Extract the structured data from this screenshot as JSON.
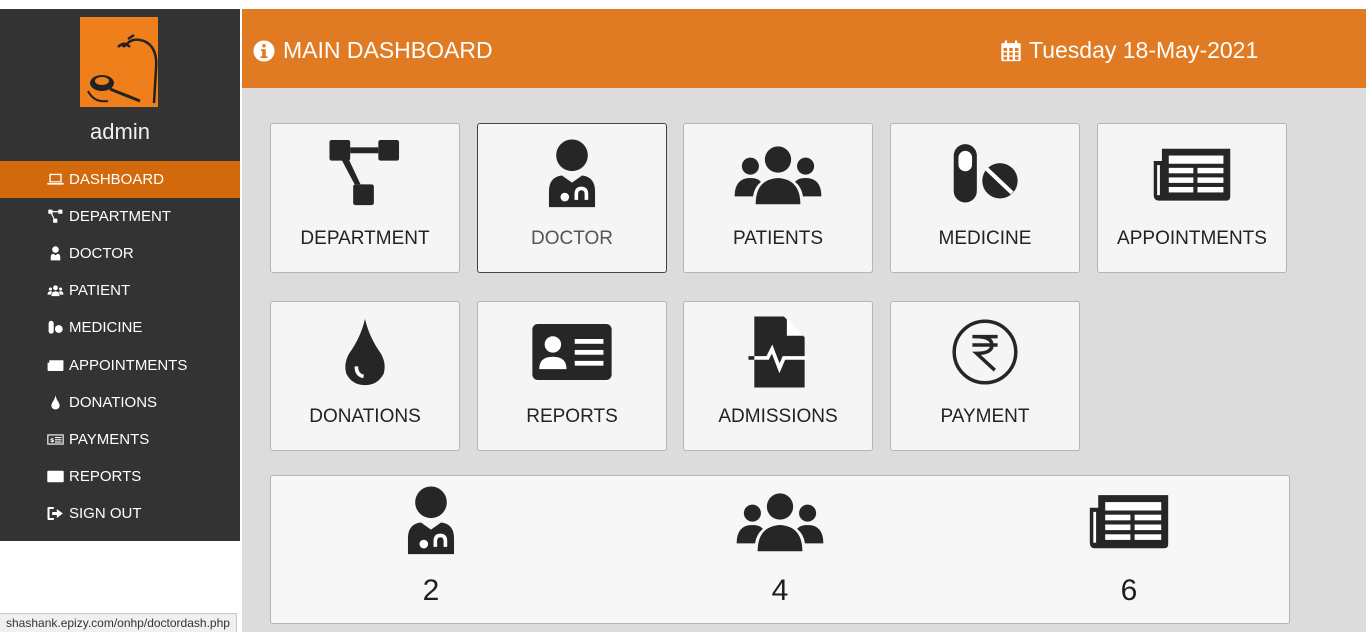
{
  "sidebar": {
    "user": "admin",
    "items": [
      {
        "label": "DASHBOARD",
        "icon": "laptop-icon",
        "active": true
      },
      {
        "label": "DEPARTMENT",
        "icon": "sitemap-icon"
      },
      {
        "label": "DOCTOR",
        "icon": "doctor-icon"
      },
      {
        "label": "PATIENT",
        "icon": "users-icon"
      },
      {
        "label": "MEDICINE",
        "icon": "pills-icon"
      },
      {
        "label": "APPOINTMENTS",
        "icon": "newspaper-icon"
      },
      {
        "label": "DONATIONS",
        "icon": "tint-icon"
      },
      {
        "label": "PAYMENTS",
        "icon": "money-icon"
      },
      {
        "label": "REPORTS",
        "icon": "id-card-icon"
      },
      {
        "label": "SIGN OUT",
        "icon": "sign-out-icon"
      }
    ]
  },
  "header": {
    "title": "MAIN DASHBOARD",
    "date": "Tuesday 18-May-2021"
  },
  "tiles": [
    {
      "label": "DEPARTMENT",
      "icon": "sitemap-icon"
    },
    {
      "label": "DOCTOR",
      "icon": "doctor-icon",
      "selected": true
    },
    {
      "label": "PATIENTS",
      "icon": "users-icon"
    },
    {
      "label": "MEDICINE",
      "icon": "pills-icon"
    },
    {
      "label": "APPOINTMENTS",
      "icon": "newspaper-icon"
    },
    {
      "label": "DONATIONS",
      "icon": "tint-icon"
    },
    {
      "label": "REPORTS",
      "icon": "id-card-icon"
    },
    {
      "label": "ADMISSIONS",
      "icon": "file-medical-icon"
    },
    {
      "label": "PAYMENT",
      "icon": "rupee-icon"
    }
  ],
  "stats": [
    {
      "icon": "doctor-icon",
      "value": "2"
    },
    {
      "icon": "users-icon",
      "value": "4"
    },
    {
      "icon": "newspaper-icon",
      "value": "6"
    }
  ],
  "status_url": "shashank.epizy.com/onhp/doctordash.php",
  "colors": {
    "accent": "#e07b24",
    "active_nav": "#d3690d",
    "sidebar_bg": "#333333",
    "main_bg": "#dcdcdc"
  }
}
